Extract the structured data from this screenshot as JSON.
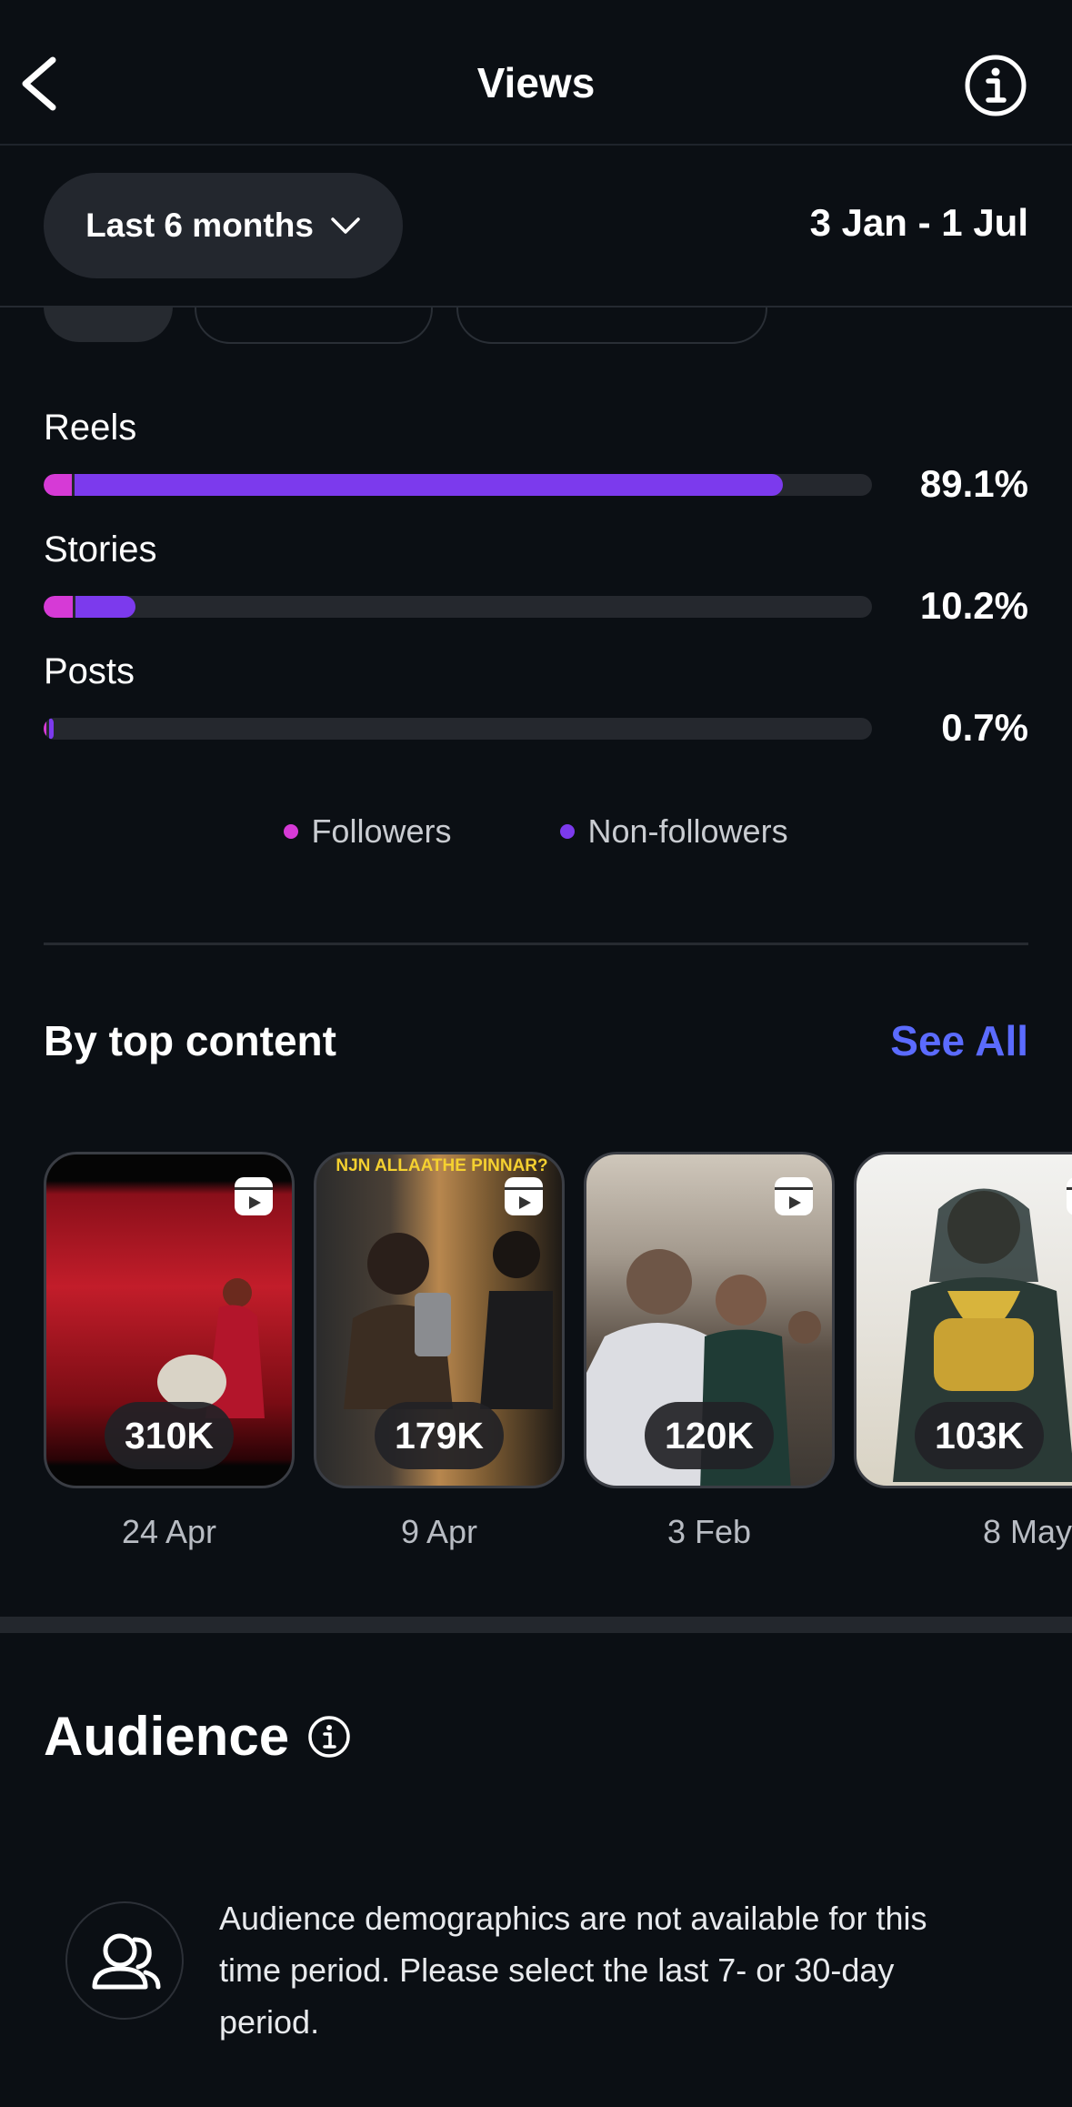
{
  "header": {
    "title": "Views"
  },
  "filters": {
    "period": "Last 6 months",
    "date_range": "3 Jan - 1 Jul"
  },
  "content_breakdown": [
    {
      "label": "Reels",
      "percent": "89.1%",
      "followers_fraction": 0.034,
      "nonfollowers_fraction": 0.855
    },
    {
      "label": "Stories",
      "percent": "10.2%",
      "followers_fraction": 0.035,
      "nonfollowers_fraction": 0.072
    },
    {
      "label": "Posts",
      "percent": "0.7%",
      "followers_fraction": 0.002,
      "nonfollowers_fraction": 0.006
    }
  ],
  "legend": [
    {
      "label": "Followers",
      "color": "#d63ad6"
    },
    {
      "label": "Non-followers",
      "color": "#7c3aed"
    }
  ],
  "top_content": {
    "title": "By top content",
    "see_all": "See All",
    "items": [
      {
        "count": "310K",
        "date": "24 Apr"
      },
      {
        "count": "179K",
        "date": "9 Apr",
        "overlay_text": "NJN ALLAATHE PINNAR?"
      },
      {
        "count": "120K",
        "date": "3 Feb"
      },
      {
        "count": "103K",
        "date": "8 May"
      }
    ]
  },
  "audience": {
    "title": "Audience",
    "message": "Audience demographics are not available for this time period. Please select the last 7- or 30-day period."
  },
  "colors": {
    "background": "#0b0f14",
    "accent_link": "#5b6bff",
    "followers": "#d63ad6",
    "nonfollowers": "#7c3aed"
  }
}
